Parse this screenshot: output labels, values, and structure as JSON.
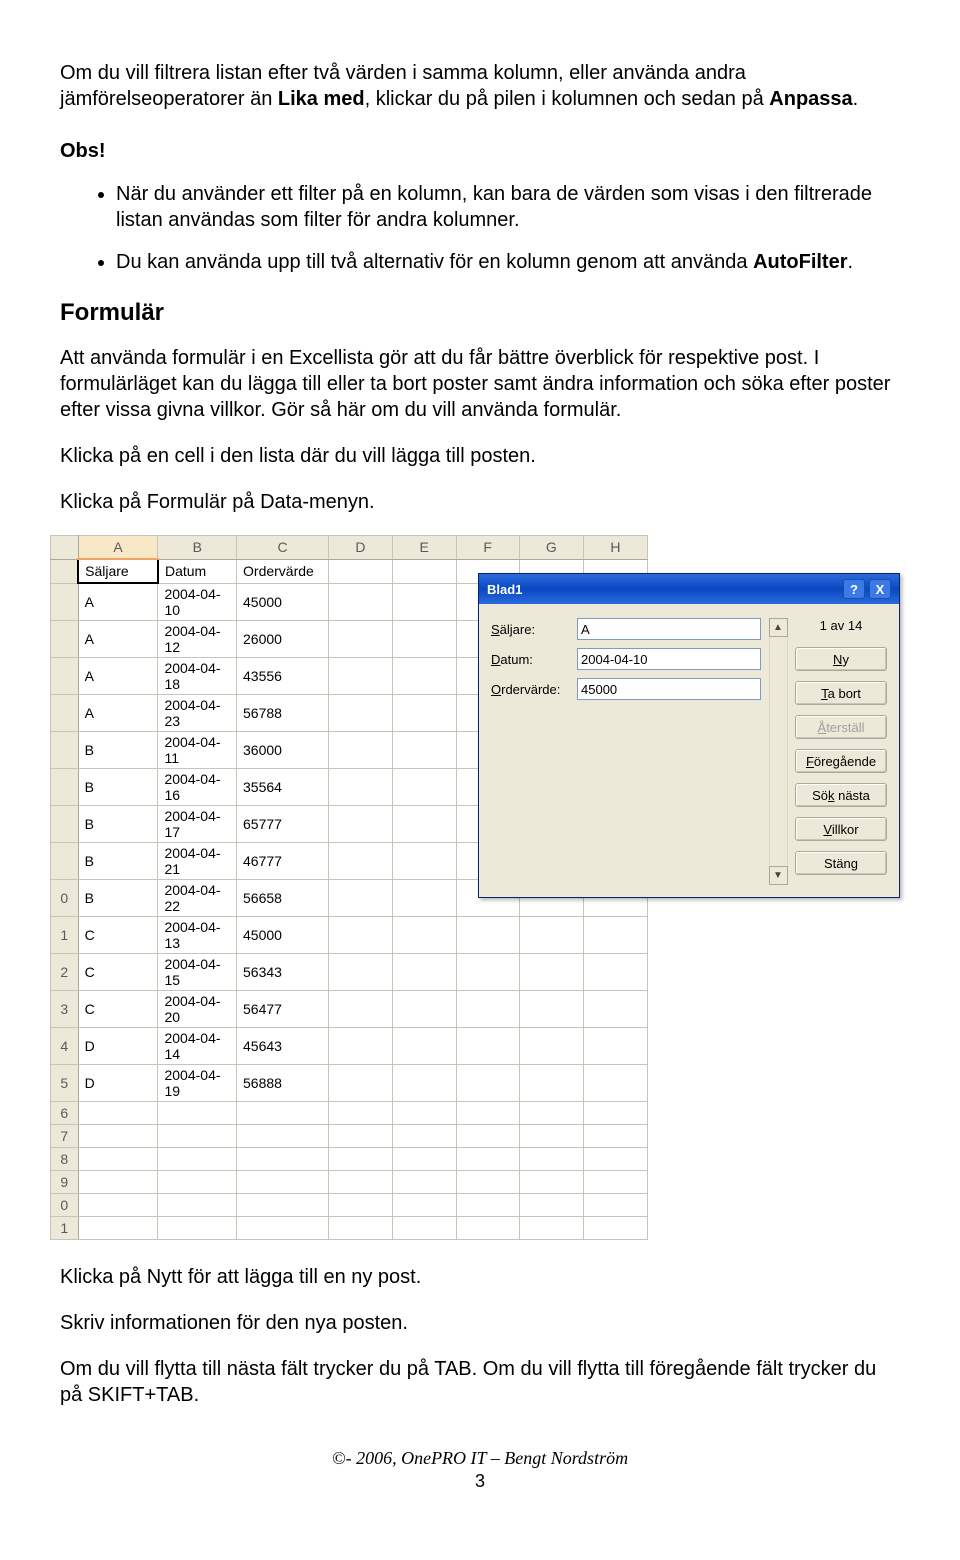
{
  "intro": {
    "pre": "Om du vill filtrera listan efter två värden i samma kolumn, eller använda andra jämförelseoperatorer än ",
    "bold1": "Lika med",
    "mid": ", klickar du på pilen i kolumnen och sedan på ",
    "bold2": "Anpassa",
    "post": "."
  },
  "obs_label": "Obs!",
  "bullets": [
    "När du använder ett filter på en kolumn, kan bara de värden som visas i den filtrerade listan användas som filter för andra kolumner.",
    "Du kan använda upp till två alternativ för en kolumn genom att använda AutoFilter."
  ],
  "bullet2_bold": "AutoFilter",
  "heading_formular": "Formulär",
  "para1": "Att använda formulär i en Excellista gör att du får bättre överblick för respektive post. I formulärläget kan du lägga till eller ta bort poster samt ändra information och söka efter poster efter vissa givna villkor. Gör så här om du vill använda formulär.",
  "para2": "Klicka på en cell i den lista där du vill lägga till posten.",
  "para3": "Klicka på Formulär på Data-menyn.",
  "sheet": {
    "columns": [
      "A",
      "B",
      "C",
      "D",
      "E",
      "F",
      "G",
      "H"
    ],
    "headers": [
      "Säljare",
      "Datum",
      "Ordervärde"
    ],
    "visible_row_numbers_top": "",
    "rows": [
      {
        "n": "",
        "c": [
          "A",
          "2004-04-10",
          "45000"
        ]
      },
      {
        "n": "",
        "c": [
          "A",
          "2004-04-12",
          "26000"
        ]
      },
      {
        "n": "",
        "c": [
          "A",
          "2004-04-18",
          "43556"
        ]
      },
      {
        "n": "",
        "c": [
          "A",
          "2004-04-23",
          "56788"
        ]
      },
      {
        "n": "",
        "c": [
          "B",
          "2004-04-11",
          "36000"
        ]
      },
      {
        "n": "",
        "c": [
          "B",
          "2004-04-16",
          "35564"
        ]
      },
      {
        "n": "",
        "c": [
          "B",
          "2004-04-17",
          "65777"
        ]
      },
      {
        "n": "",
        "c": [
          "B",
          "2004-04-21",
          "46777"
        ]
      },
      {
        "n": "0",
        "c": [
          "B",
          "2004-04-22",
          "56658"
        ]
      },
      {
        "n": "1",
        "c": [
          "C",
          "2004-04-13",
          "45000"
        ]
      },
      {
        "n": "2",
        "c": [
          "C",
          "2004-04-15",
          "56343"
        ]
      },
      {
        "n": "3",
        "c": [
          "C",
          "2004-04-20",
          "56477"
        ]
      },
      {
        "n": "4",
        "c": [
          "D",
          "2004-04-14",
          "45643"
        ]
      },
      {
        "n": "5",
        "c": [
          "D",
          "2004-04-19",
          "56888"
        ]
      },
      {
        "n": "6",
        "c": [
          "",
          "",
          ""
        ]
      },
      {
        "n": "7",
        "c": [
          "",
          "",
          ""
        ]
      },
      {
        "n": "8",
        "c": [
          "",
          "",
          ""
        ]
      },
      {
        "n": "9",
        "c": [
          "",
          "",
          ""
        ]
      },
      {
        "n": "0",
        "c": [
          "",
          "",
          ""
        ]
      },
      {
        "n": "1",
        "c": [
          "",
          "",
          ""
        ]
      }
    ]
  },
  "dialog": {
    "title": "Blad1",
    "help_icon": "?",
    "close_icon": "X",
    "fields": {
      "saljare_label_pre": "",
      "saljare_label_ul": "S",
      "saljare_label_post": "äljare:",
      "datum_label_pre": "",
      "datum_label_ul": "D",
      "datum_label_post": "atum:",
      "order_label_pre": "",
      "order_label_ul": "O",
      "order_label_post": "rdervärde:",
      "saljare_value": "A",
      "datum_value": "2004-04-10",
      "order_value": "45000"
    },
    "counter": "1 av 14",
    "scroll_up": "▲",
    "scroll_down": "▼",
    "buttons": {
      "ny_ul": "N",
      "ny_post": "y",
      "ta_ul": "T",
      "ta_post": "a bort",
      "aterstall_ul": "Å",
      "aterstall_post": "terställ",
      "foregaende_ul": "F",
      "foregaende_post": "öregående",
      "sok_pre": "Sö",
      "sok_ul": "k",
      "sok_post": " nästa",
      "villkor_ul": "V",
      "villkor_post": "illkor",
      "stang_pre": "Stän",
      "stang_ul": "g",
      "stang_post": ""
    }
  },
  "post1": "Klicka på Nytt för att lägga till en ny post.",
  "post2": "Skriv informationen för den nya posten.",
  "post3": "Om du vill flytta till nästa fält trycker du på TAB. Om du vill flytta till föregående fält trycker du på SKIFT+TAB.",
  "footer": {
    "copyright": "©- 2006, OnePRO IT – Bengt Nordström",
    "page": "3"
  }
}
